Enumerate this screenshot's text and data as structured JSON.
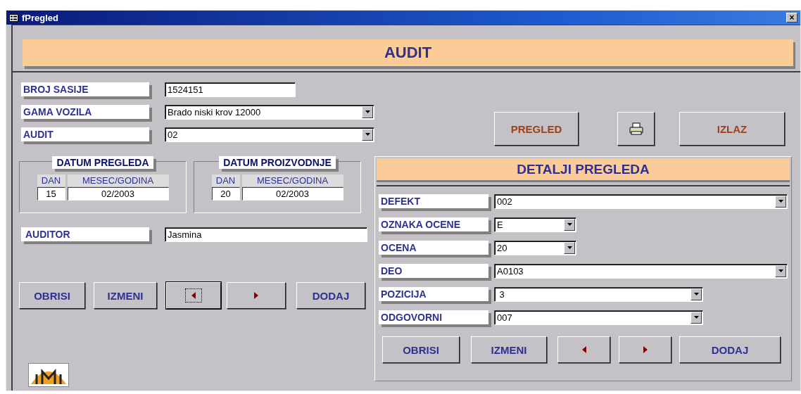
{
  "window": {
    "title": "fPregled",
    "close": "×"
  },
  "header": {
    "title": "AUDIT"
  },
  "fields": [
    {
      "label": "BROJ SASIJE",
      "value": "1524151",
      "kind": "text"
    },
    {
      "label": "GAMA VOZILA",
      "value": "Brado niski krov 12000",
      "kind": "combo"
    },
    {
      "label": "AUDIT",
      "value": "02",
      "kind": "combo"
    }
  ],
  "actions": [
    {
      "kind": "text",
      "label": "PREGLED"
    },
    {
      "kind": "print"
    },
    {
      "kind": "text",
      "label": "IZLAZ"
    }
  ],
  "date_groups": [
    {
      "title": "DATUM PREGLEDA",
      "day_label": "DAN",
      "month_label": "MESEC/GODINA",
      "day": "15",
      "month": "02/2003"
    },
    {
      "title": "DATUM PROIZVODNJE",
      "day_label": "DAN",
      "month_label": "MESEC/GODINA",
      "day": "20",
      "month": "02/2003"
    }
  ],
  "auditor": {
    "label": "AUDITOR",
    "value": "Jasmina"
  },
  "record_buttons": [
    {
      "kind": "text",
      "label": "OBRISI",
      "focused": false
    },
    {
      "kind": "text",
      "label": "IZMENI",
      "focused": false
    },
    {
      "kind": "prev",
      "focused": true
    },
    {
      "kind": "next",
      "focused": false
    },
    {
      "kind": "text",
      "label": "DODAJ",
      "focused": false
    }
  ],
  "details": {
    "title": "DETALJI PREGLEDA",
    "fields": [
      {
        "label": "DEFEKT",
        "value": "002"
      },
      {
        "label": "OZNAKA OCENE",
        "value": "E"
      },
      {
        "label": "OCENA",
        "value": "20"
      },
      {
        "label": "DEO",
        "value": "A0103"
      },
      {
        "label": "POZICIJA",
        "value": " 3"
      },
      {
        "label": "ODGOVORNI",
        "value": "007"
      }
    ],
    "buttons": [
      {
        "kind": "text",
        "label": "OBRISI",
        "focused": false
      },
      {
        "kind": "text",
        "label": "IZMENI",
        "focused": false
      },
      {
        "kind": "prev",
        "focused": false
      },
      {
        "kind": "next",
        "focused": false
      },
      {
        "kind": "text",
        "label": "DODAJ",
        "focused": false
      }
    ]
  }
}
